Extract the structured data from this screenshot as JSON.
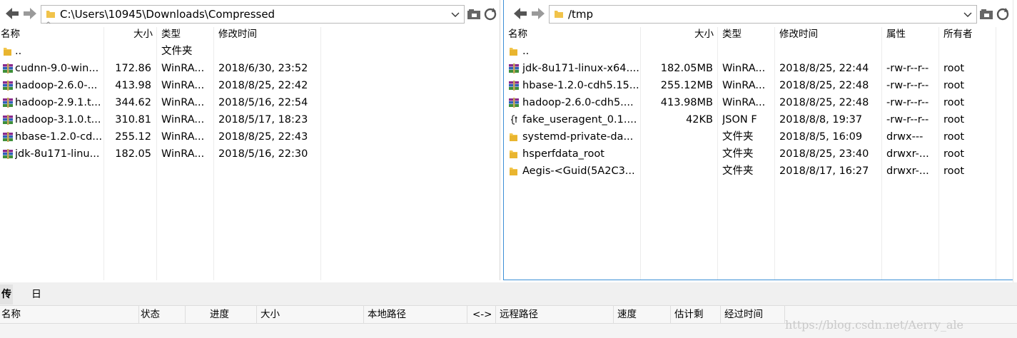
{
  "left": {
    "path": "C:\\Users\\10945\\Downloads\\Compressed",
    "headers": {
      "name": "名称",
      "size": "大小",
      "type": "类型",
      "modified": "修改时间"
    },
    "rows": [
      {
        "icon": "folder-icon",
        "name": "..",
        "size": "",
        "type": "文件夹",
        "modified": ""
      },
      {
        "icon": "rar-archive-icon",
        "name": "cudnn-9.0-win...",
        "size": "172.86",
        "type": "WinRA...",
        "modified": "2018/6/30, 23:52"
      },
      {
        "icon": "rar-archive-icon",
        "name": "hadoop-2.6.0-...",
        "size": "413.98",
        "type": "WinRA...",
        "modified": "2018/8/25, 22:42"
      },
      {
        "icon": "rar-archive-icon",
        "name": "hadoop-2.9.1.t...",
        "size": "344.62",
        "type": "WinRA...",
        "modified": "2018/5/16, 22:54"
      },
      {
        "icon": "rar-archive-icon",
        "name": "hadoop-3.1.0.t...",
        "size": "310.81",
        "type": "WinRA...",
        "modified": "2018/5/17, 18:23"
      },
      {
        "icon": "rar-archive-icon",
        "name": "hbase-1.2.0-cd...",
        "size": "255.12",
        "type": "WinRA...",
        "modified": "2018/8/25, 22:43"
      },
      {
        "icon": "rar-archive-icon",
        "name": "jdk-8u171-linu...",
        "size": "182.05",
        "type": "WinRA...",
        "modified": "2018/5/16, 22:30"
      }
    ]
  },
  "right": {
    "path": "/tmp",
    "headers": {
      "name": "名称",
      "size": "大小",
      "type": "类型",
      "modified": "修改时间",
      "attrs": "属性",
      "owner": "所有者"
    },
    "rows": [
      {
        "icon": "folder-icon",
        "name": "..",
        "size": "",
        "type": "",
        "modified": "",
        "attrs": "",
        "owner": ""
      },
      {
        "icon": "rar-archive-icon",
        "name": "jdk-8u171-linux-x64....",
        "size": "182.05MB",
        "type": "WinRA...",
        "modified": "2018/8/25, 22:44",
        "attrs": "-rw-r--r--",
        "owner": "root"
      },
      {
        "icon": "rar-archive-icon",
        "name": "hbase-1.2.0-cdh5.15...",
        "size": "255.12MB",
        "type": "WinRA...",
        "modified": "2018/8/25, 22:48",
        "attrs": "-rw-r--r--",
        "owner": "root"
      },
      {
        "icon": "rar-archive-icon",
        "name": "hadoop-2.6.0-cdh5....",
        "size": "413.98MB",
        "type": "WinRA...",
        "modified": "2018/8/25, 22:48",
        "attrs": "-rw-r--r--",
        "owner": "root"
      },
      {
        "icon": "json-file-icon",
        "name": "fake_useragent_0.1....",
        "size": "42KB",
        "type": "JSON F",
        "modified": "2018/8/8, 19:37",
        "attrs": "-rw-r--r--",
        "owner": "root"
      },
      {
        "icon": "folder-icon",
        "name": "systemd-private-da...",
        "size": "",
        "type": "文件夹",
        "modified": "2018/8/5, 16:09",
        "attrs": "drwx---",
        "owner": "root"
      },
      {
        "icon": "folder-icon",
        "name": "hsperfdata_root",
        "size": "",
        "type": "文件夹",
        "modified": "2018/8/25, 23:40",
        "attrs": "drwxr-...",
        "owner": "root"
      },
      {
        "icon": "folder-icon",
        "name": "Aegis-<Guid(5A2C3...",
        "size": "",
        "type": "文件夹",
        "modified": "2018/8/17, 16:27",
        "attrs": "drwxr-...",
        "owner": "root"
      }
    ]
  },
  "transfer": {
    "tabs": [
      "传输",
      "日志"
    ],
    "headers": [
      "名称",
      "状态",
      "进度",
      "大小",
      "本地路径",
      "<->",
      "远程路径",
      "速度",
      "估计剩",
      "经过时间"
    ]
  },
  "watermark": "https://blog.csdn.net/Aerry_ale"
}
